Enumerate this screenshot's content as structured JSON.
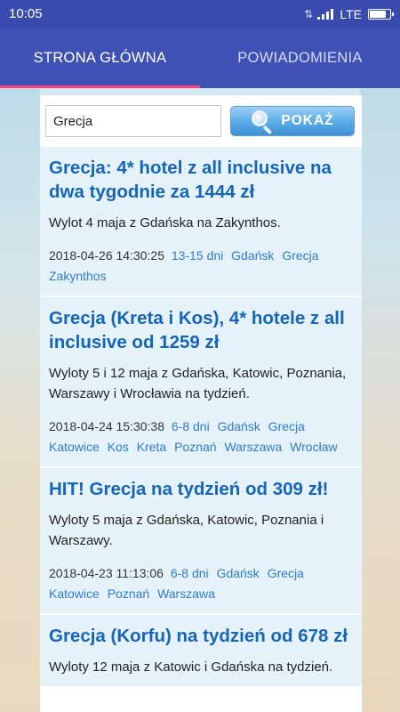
{
  "status": {
    "time": "10:05",
    "network": "LTE",
    "battery_level": 0.85
  },
  "tabs": [
    {
      "label": "STRONA GŁÓWNA",
      "active": true
    },
    {
      "label": "POWIADOMIENIA",
      "active": false
    }
  ],
  "search": {
    "value": "Grecja",
    "button_label": "POKAŻ"
  },
  "offers": [
    {
      "title": "Grecja: 4* hotel z all inclusive na dwa tygodnie za 1444 zł",
      "description": "Wylot 4 maja z Gdańska na Zakynthos.",
      "date": "2018-04-26 14:30:25",
      "tags": [
        "13-15 dni",
        "Gdańsk",
        "Grecja",
        "Zakynthos"
      ]
    },
    {
      "title": "Grecja (Kreta i Kos), 4* hotele z all inclusive od 1259 zł",
      "description": "Wyloty 5 i 12 maja z Gdańska, Katowic, Poznania, Warszawy i Wrocławia na tydzień.",
      "date": "2018-04-24 15:30:38",
      "tags": [
        "6-8 dni",
        "Gdańsk",
        "Grecja",
        "Katowice",
        "Kos",
        "Kreta",
        "Poznań",
        "Warszawa",
        "Wrocław"
      ]
    },
    {
      "title": "HIT! Grecja na tydzień od 309 zł!",
      "description": "Wyloty 5 maja z Gdańska, Katowic, Poznania i Warszawy.",
      "date": "2018-04-23 11:13:06",
      "tags": [
        "6-8 dni",
        "Gdańsk",
        "Grecja",
        "Katowice",
        "Poznań",
        "Warszawa"
      ]
    },
    {
      "title": "Grecja (Korfu) na tydzień od 678 zł",
      "description": "Wyloty 12 maja z Katowic i Gdańska na tydzień.",
      "date": "",
      "tags": []
    }
  ],
  "colors": {
    "primary": "#3f51b5",
    "accent": "#ff4081",
    "title": "#1565b8",
    "tag": "#2f7bd0",
    "card": "#e6f2fa"
  }
}
